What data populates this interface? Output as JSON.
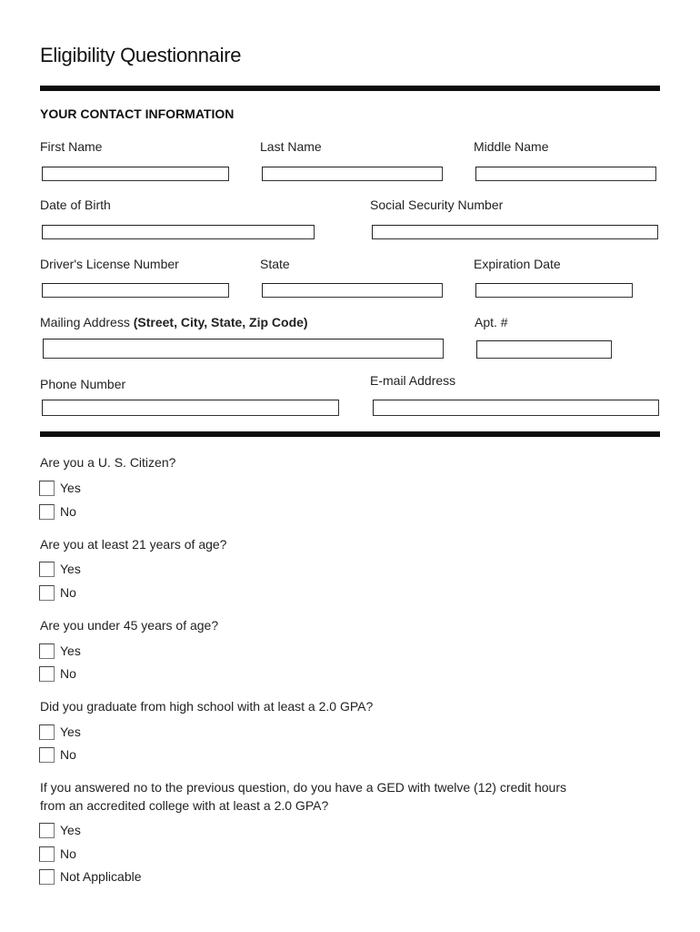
{
  "title": "Eligibility Questionnaire",
  "section_title": "YOUR CONTACT INFORMATION",
  "fields": {
    "first_name": {
      "label": "First Name",
      "value": ""
    },
    "last_name": {
      "label": "Last Name",
      "value": ""
    },
    "middle_name": {
      "label": "Middle Name",
      "value": ""
    },
    "dob": {
      "label": "Date of Birth",
      "value": ""
    },
    "ssn": {
      "label": "Social Security Number",
      "value": ""
    },
    "license": {
      "label": "Driver's License Number",
      "value": ""
    },
    "state": {
      "label": "State",
      "value": ""
    },
    "expiration": {
      "label": "Expiration Date",
      "value": ""
    },
    "address": {
      "label": "Mailing Address ",
      "label_bold": "(Street, City, State, Zip Code)",
      "value": ""
    },
    "apt": {
      "label": "Apt. #",
      "value": ""
    },
    "phone": {
      "label": "Phone Number",
      "value": ""
    },
    "email": {
      "label": "E-mail Address",
      "value": ""
    }
  },
  "questions": [
    {
      "text": "Are you a U. S. Citizen?",
      "options": [
        "Yes",
        "No"
      ]
    },
    {
      "text": "Are you at least 21 years of age?",
      "options": [
        "Yes",
        "No"
      ]
    },
    {
      "text": "Are you under 45 years of age?",
      "options": [
        "Yes",
        "No"
      ]
    },
    {
      "text": "Did you graduate from high school with at least a 2.0 GPA?",
      "options": [
        "Yes",
        "No"
      ]
    },
    {
      "text_line1": "If you answered no to the previous question, do you have a GED with twelve (12) credit hours",
      "text_line2": "from an accredited college with at least a 2.0 GPA?",
      "options": [
        "Yes",
        "No",
        "Not Applicable"
      ]
    }
  ]
}
